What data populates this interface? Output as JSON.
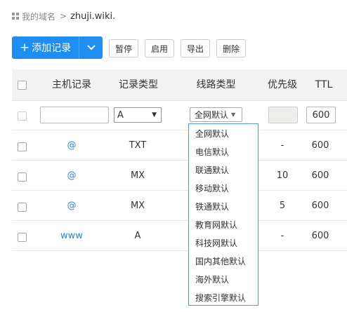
{
  "breadcrumb": {
    "root": "我的域名",
    "separator": ">",
    "domain": "zhuji.wiki."
  },
  "toolbar": {
    "add_label": "添加记录",
    "add_plus": "+",
    "pause_label": "暂停",
    "enable_label": "启用",
    "export_label": "导出",
    "delete_label": "删除",
    "accent_color": "#1e8ef2"
  },
  "table": {
    "headers": {
      "host": "主机记录",
      "type": "记录类型",
      "line": "线路类型",
      "priority": "优先级",
      "ttl": "TTL"
    },
    "new_row": {
      "host_value": "",
      "type_value": "A",
      "line_value": "全网默认",
      "priority_value": "",
      "ttl_value": "600"
    },
    "rows": [
      {
        "host": "@",
        "type": "TXT",
        "priority": "-",
        "ttl": "600"
      },
      {
        "host": "@",
        "type": "MX",
        "priority": "10",
        "ttl": "600"
      },
      {
        "host": "@",
        "type": "MX",
        "priority": "5",
        "ttl": "600"
      },
      {
        "host": "www",
        "type": "A",
        "priority": "-",
        "ttl": "600"
      }
    ]
  },
  "line_dropdown": {
    "options": [
      "全网默认",
      "电信默认",
      "联通默认",
      "移动默认",
      "铁通默认",
      "教育网默认",
      "科技网默认",
      "国内其他默认",
      "海外默认",
      "搜索引擎默认"
    ]
  }
}
